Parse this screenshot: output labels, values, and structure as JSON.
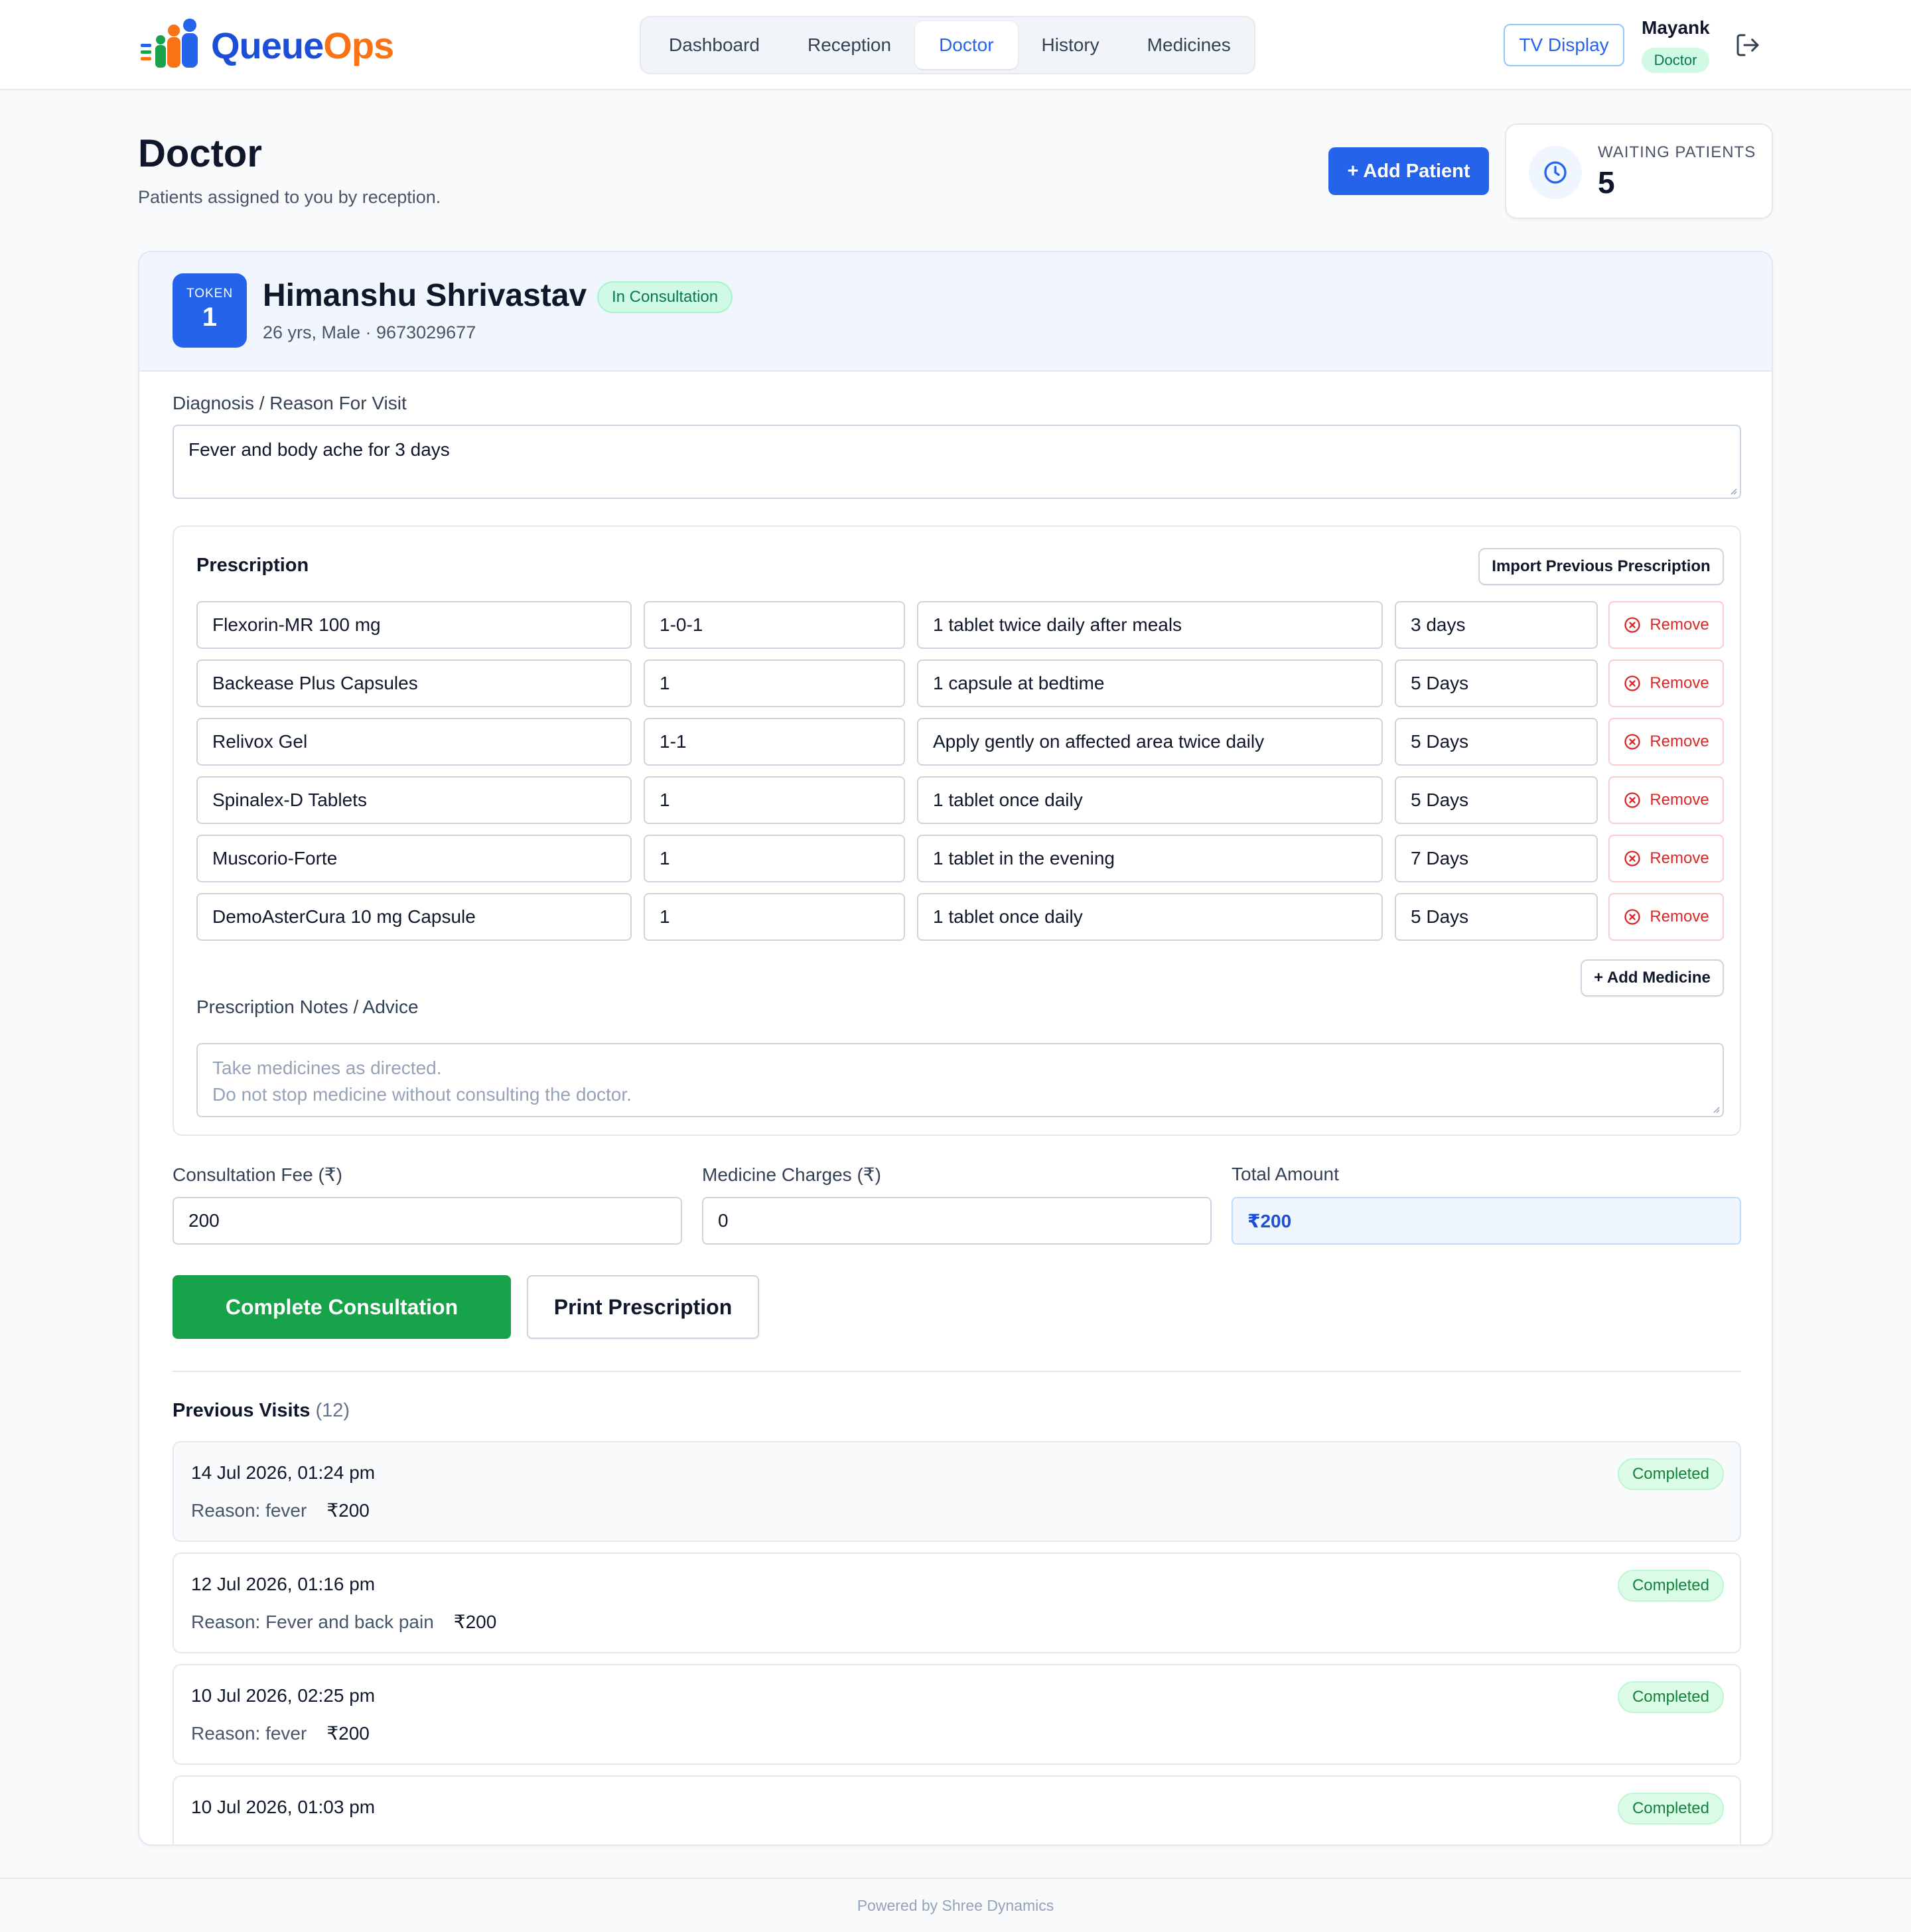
{
  "brand": {
    "queue": "Queue",
    "ops": "Ops"
  },
  "nav": {
    "items": [
      "Dashboard",
      "Reception",
      "Doctor",
      "History",
      "Medicines"
    ],
    "active": "Doctor"
  },
  "header": {
    "tv_display": "TV Display",
    "user_name": "Mayank",
    "user_role": "Doctor"
  },
  "page": {
    "title": "Doctor",
    "subtitle": "Patients assigned to you by reception.",
    "add_patient": "+ Add Patient"
  },
  "waiting": {
    "label": "WAITING PATIENTS",
    "count": "5"
  },
  "patient": {
    "token_label": "TOKEN",
    "token": "1",
    "name": "Himanshu Shrivastav",
    "status": "In Consultation",
    "meta": "26 yrs, Male · 9673029677"
  },
  "diagnosis": {
    "label": "Diagnosis / Reason For Visit",
    "value": "Fever and body ache for 3 days"
  },
  "prescription": {
    "title": "Prescription",
    "import_label": "Import Previous Prescription",
    "remove_label": "Remove",
    "add_medicine_label": "+ Add Medicine",
    "rows": [
      {
        "medicine": "Flexorin-MR 100 mg",
        "dosage": "1-0-1",
        "instructions": "1 tablet twice daily after meals",
        "duration": "3 days"
      },
      {
        "medicine": "Backease Plus Capsules",
        "dosage": "1",
        "instructions": "1 capsule at bedtime",
        "duration": "5 Days"
      },
      {
        "medicine": "Relivox Gel",
        "dosage": "1-1",
        "instructions": "Apply gently on affected area twice daily",
        "duration": "5 Days"
      },
      {
        "medicine": "Spinalex-D Tablets",
        "dosage": "1",
        "instructions": "1 tablet once daily",
        "duration": "5 Days"
      },
      {
        "medicine": "Muscorio-Forte",
        "dosage": "1",
        "instructions": "1 tablet in the evening",
        "duration": "7 Days"
      },
      {
        "medicine": "DemoAsterCura 10 mg Capsule",
        "dosage": "1",
        "instructions": "1 tablet once daily",
        "duration": "5 Days"
      }
    ],
    "notes_label": "Prescription Notes / Advice",
    "notes_placeholder_line1": "Take medicines as directed.",
    "notes_placeholder_line2": "Do not stop medicine without consulting the doctor."
  },
  "billing": {
    "consultation_label": "Consultation Fee (₹)",
    "consultation_value": "200",
    "medicine_label": "Medicine Charges (₹)",
    "medicine_value": "0",
    "total_label": "Total Amount",
    "total_value": "₹200"
  },
  "actions": {
    "complete": "Complete Consultation",
    "print": "Print Prescription"
  },
  "previous_visits": {
    "title": "Previous Visits",
    "count": "(12)",
    "items": [
      {
        "date": "14 Jul 2026, 01:24 pm",
        "reason": "Reason: fever",
        "amount": "₹200",
        "status": "Completed"
      },
      {
        "date": "12 Jul 2026, 01:16 pm",
        "reason": "Reason: Fever and back pain",
        "amount": "₹200",
        "status": "Completed"
      },
      {
        "date": "10 Jul 2026, 02:25 pm",
        "reason": "Reason: fever",
        "amount": "₹200",
        "status": "Completed"
      },
      {
        "date": "10 Jul 2026, 01:03 pm",
        "status": "Completed"
      }
    ]
  },
  "footer": "Powered by Shree Dynamics",
  "colors": {
    "primary": "#2563eb",
    "success": "#16a34a",
    "danger": "#dc2626",
    "brand_orange": "#f97316"
  }
}
